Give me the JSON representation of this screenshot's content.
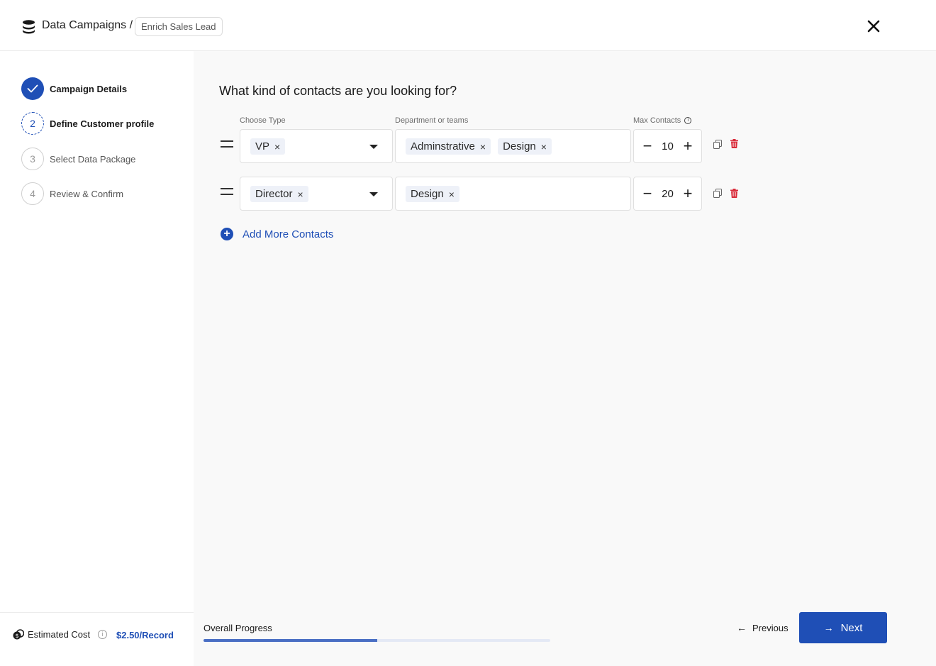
{
  "header": {
    "title": "Data Campaigns /",
    "breadcrumb": "Enrich Sales Lead",
    "icon": "database-icon",
    "close_icon": "close-icon"
  },
  "sidebar": {
    "steps": [
      {
        "number": "",
        "label": "Campaign Details",
        "state": "completed"
      },
      {
        "number": "2",
        "label": "Define Customer profile",
        "state": "active"
      },
      {
        "number": "3",
        "label": "Select Data Package",
        "state": "pending"
      },
      {
        "number": "4",
        "label": "Review & Confirm",
        "state": "pending"
      }
    ],
    "cost": {
      "label": "Estimated Cost",
      "value": "$2.50/Record"
    }
  },
  "main": {
    "question": "What kind of contacts are you looking for?",
    "columns": {
      "type": "Choose Type",
      "department": "Department or teams",
      "max": "Max Contacts"
    },
    "rows": [
      {
        "types": [
          "VP"
        ],
        "departments": [
          "Adminstrative",
          "Design"
        ],
        "max": "10"
      },
      {
        "types": [
          "Director"
        ],
        "departments": [
          "Design"
        ],
        "max": "20"
      }
    ],
    "add_more": "Add More Contacts",
    "progress": {
      "label": "Overall Progress",
      "percent": 50
    },
    "buttons": {
      "previous": "Previous",
      "next": "Next"
    }
  },
  "colors": {
    "accent": "#1f4fb6",
    "danger": "#d92b3a",
    "chip_bg": "#eef1f8"
  }
}
